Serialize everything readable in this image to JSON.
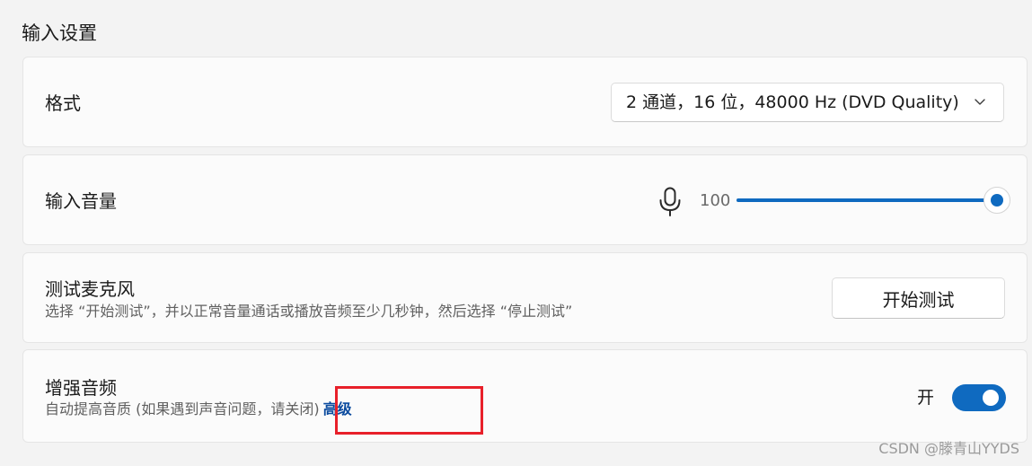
{
  "section": {
    "title": "输入设置"
  },
  "format": {
    "label": "格式",
    "selected_value": "2 通道，16 位，48000 Hz (DVD Quality)",
    "chevron_icon": "chevron-down-icon"
  },
  "input_volume": {
    "label": "输入音量",
    "icon": "microphone-icon",
    "value_text": "100",
    "level": 1.0,
    "accent_color": "#0f6ac0"
  },
  "test_mic": {
    "title": "测试麦克风",
    "description": "选择 “开始测试”，并以正常音量通话或播放音频至少几秒钟，然后选择 “停止测试”",
    "button_label": "开始测试"
  },
  "enhance_audio": {
    "title": "增强音频",
    "description": "自动提高音质 (如果遇到声音问题，请关闭)",
    "link_label": "高级",
    "toggle_label": "开",
    "toggle_on": true
  },
  "annotation": {
    "highlight_color": "#e8202a"
  },
  "watermark": {
    "text": "CSDN @滕青山YYDS"
  }
}
